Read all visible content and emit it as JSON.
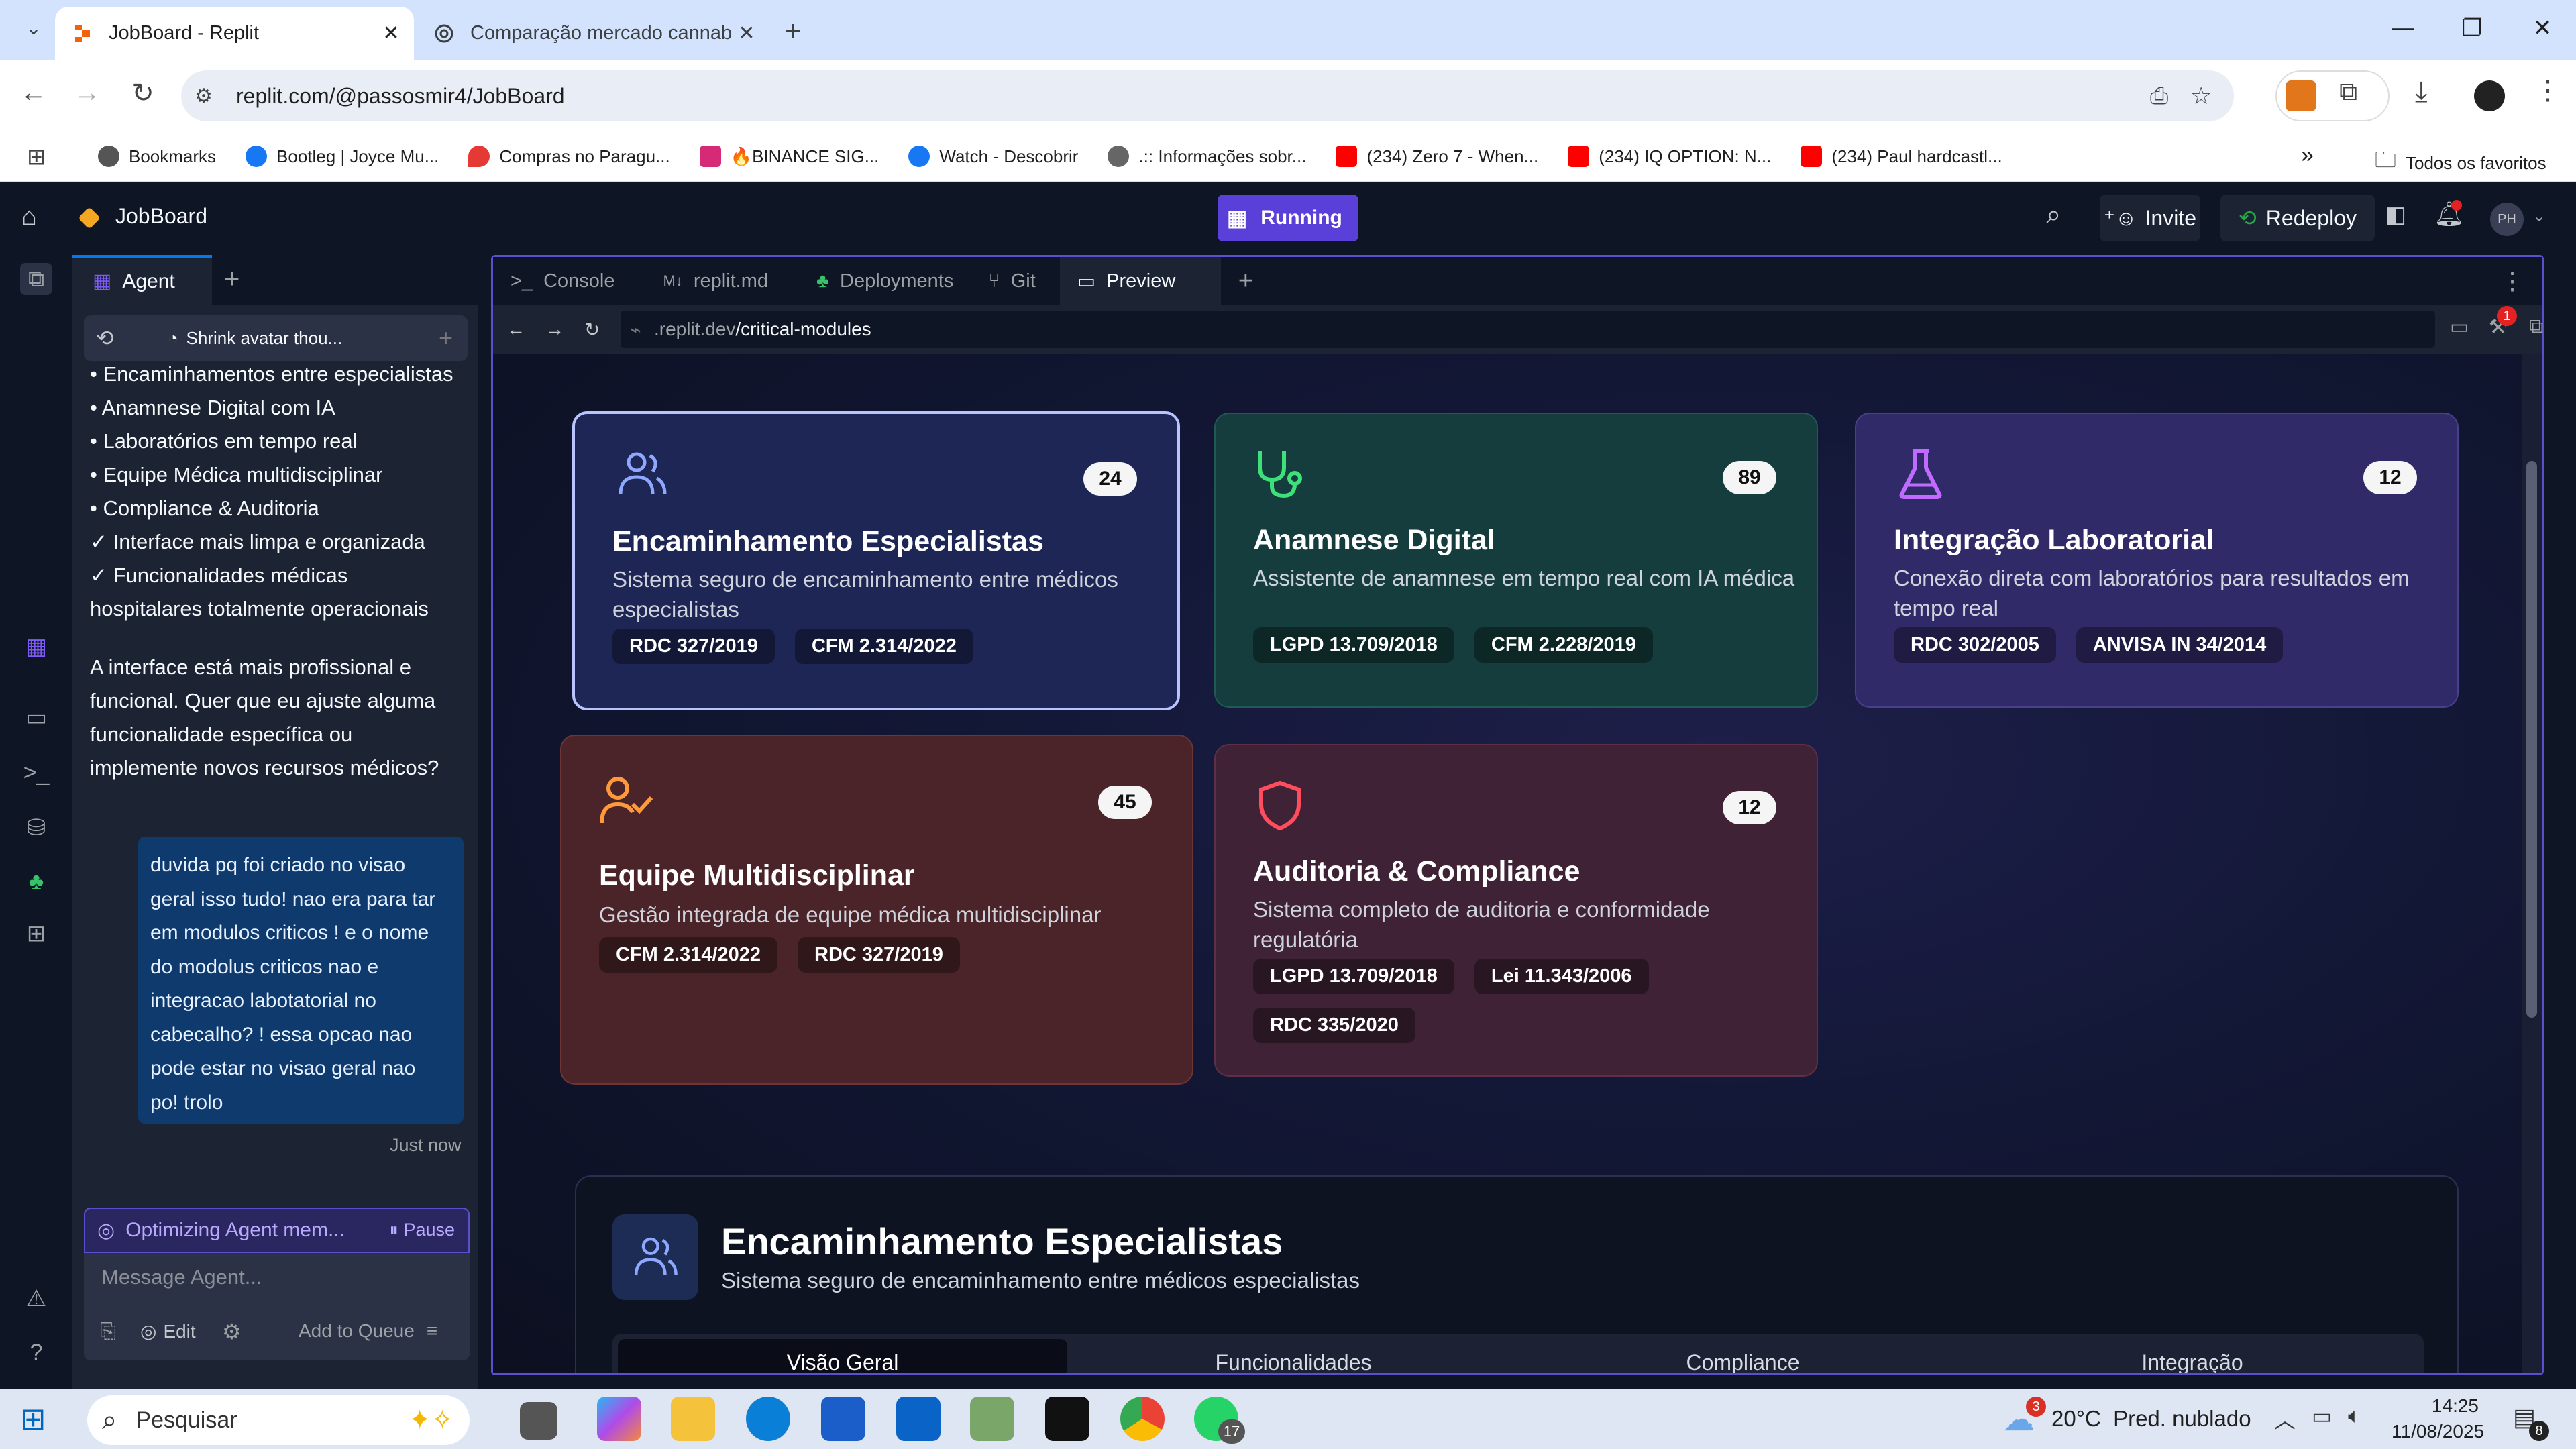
{
  "browser": {
    "tabs": [
      {
        "label": "JobBoard - Replit",
        "active": true
      },
      {
        "label": "Comparação mercado cannabis",
        "active": false
      }
    ],
    "url": "replit.com/@passosmir4/JobBoard",
    "bookmarks": [
      "Bookmarks",
      "Bootleg | Joyce Mu...",
      "Compras no Paragu...",
      "🔥BINANCE SIG...",
      "Watch - Descobrir",
      ".:: Informações sobr...",
      "(234) Zero 7 - When...",
      "(234) IQ OPTION: N...",
      "(234) Paul hardcastl..."
    ],
    "bookmarks_more": "»",
    "all_bookmarks": "Todos os favoritos"
  },
  "replit": {
    "project": "JobBoard",
    "run_label": "Running",
    "invite": "Invite",
    "redeploy": "Redeploy",
    "avatar": "PH",
    "notif_count": "1",
    "agent_tab": "Agent",
    "chat_title": "Shrink avatar thou...",
    "chat_lines": [
      "• Encaminhamentos entre especialistas",
      "• Anamnese Digital com IA",
      "• Laboratórios em tempo real",
      "• Equipe Médica multidisciplinar",
      "• Compliance & Auditoria",
      "✓ Interface mais limpa e organizada",
      "✓ Funcionalidades médicas",
      "hospitalares totalmente operacionais"
    ],
    "chat_para": [
      "A interface está mais profissional e",
      "funcional. Quer que eu ajuste alguma",
      "funcionalidade específica ou",
      "implemente novos recursos médicos?"
    ],
    "user_msg": [
      "duvida pq foi criado no visao",
      "geral isso tudo! nao era para tar",
      "em modulos criticos ! e o nome",
      "do modolus criticos nao e",
      "integracao labotatorial no",
      "cabecalho? ! essa opcao nao",
      "pode estar no visao geral nao",
      "po! trolo"
    ],
    "just_now": "Just now",
    "optimizing": "Optimizing Agent mem...",
    "pause": "Pause",
    "msg_placeholder": "Message Agent...",
    "edit": "Edit",
    "add_queue": "Add to Queue",
    "pane_tabs": [
      "Console",
      "replit.md",
      "Deployments",
      "Git",
      "Preview"
    ],
    "preview_url_host": ".replit.dev",
    "preview_url_path": "/critical-modules",
    "preview_badge": "1"
  },
  "cards": [
    {
      "title": "Encaminhamento Especialistas",
      "desc": "Sistema seguro de encaminhamento entre médicos especialistas",
      "count": "24",
      "tags": [
        "RDC 327/2019",
        "CFM 2.314/2022"
      ],
      "icon": "users-icon"
    },
    {
      "title": "Anamnese Digital",
      "desc": "Assistente de anamnese em tempo real com IA médica",
      "count": "89",
      "tags": [
        "LGPD 13.709/2018",
        "CFM 2.228/2019"
      ],
      "icon": "stethoscope-icon"
    },
    {
      "title": "Integração Laboratorial",
      "desc": "Conexão direta com laboratórios para resultados em tempo real",
      "count": "12",
      "tags": [
        "RDC 302/2005",
        "ANVISA IN 34/2014"
      ],
      "icon": "flask-icon"
    },
    {
      "title": "Equipe Multidisciplinar",
      "desc": "Gestão integrada de equipe médica multidisciplinar",
      "count": "45",
      "tags": [
        "CFM 2.314/2022",
        "RDC 327/2019"
      ],
      "icon": "user-check-icon"
    },
    {
      "title": "Auditoria & Compliance",
      "desc": "Sistema completo de auditoria e conformidade regulatória",
      "count": "12",
      "tags": [
        "LGPD 13.709/2018",
        "Lei 11.343/2006",
        "RDC 335/2020"
      ],
      "icon": "shield-icon"
    }
  ],
  "detail": {
    "title": "Encaminhamento Especialistas",
    "subtitle": "Sistema seguro de encaminhamento entre médicos especialistas",
    "tabs": [
      "Visão Geral",
      "Funcionalidades",
      "Compliance",
      "Integração"
    ]
  },
  "taskbar": {
    "search": "Pesquisar",
    "weather": "20°C  Pred. nublado",
    "weather_badge": "3",
    "time": "14:25",
    "date": "11/08/2025",
    "whatsapp_badge": "17",
    "notif_badge": "8"
  }
}
